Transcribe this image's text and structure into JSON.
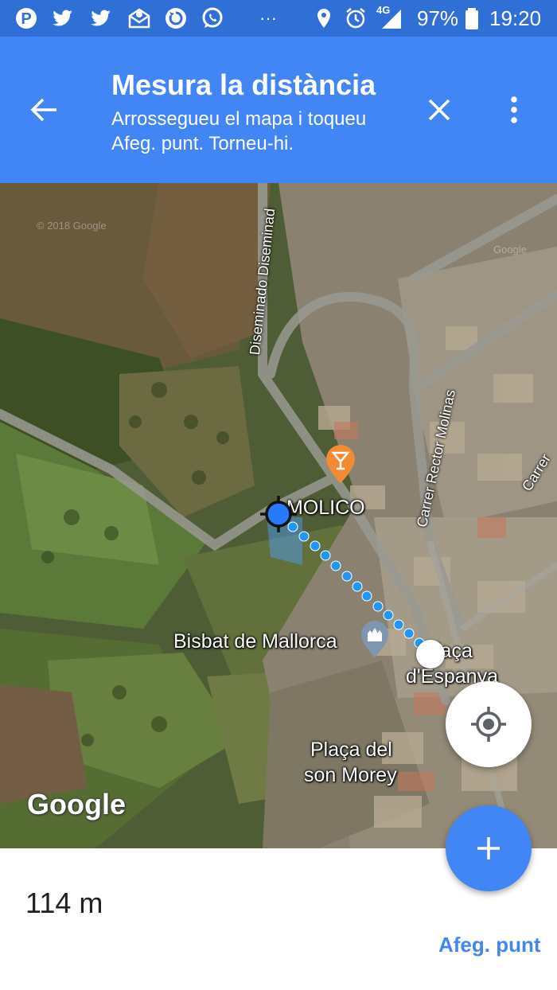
{
  "status_bar": {
    "notification_icons": [
      "pinterest-icon",
      "twitter-icon",
      "twitter-icon",
      "mail-icon",
      "sync-icon",
      "whatsapp-icon"
    ],
    "more_indicator": "···",
    "network_label": "4G",
    "battery": "97%",
    "time": "19:20"
  },
  "app_bar": {
    "title": "Mesura la distància",
    "subtitle": "Arrossegueu el mapa i toqueu Afeg. punt. Torneu-hi."
  },
  "map": {
    "labels": {
      "poi_molico": "MOLICO",
      "poi_bisbat": "Bisbat de Mallorca",
      "plaza_espanya_line1": "laça",
      "plaza_espanya_line2": "d'Espanya",
      "placa_son_morey_line1": "Plaça del",
      "placa_son_morey_line2": "son Morey",
      "street_diseminado": "Diseminado Diseminad",
      "street_rector_molinas": "Carrer Rector Molinas",
      "street_carrer": "Carrer",
      "copyright_1": "© 2018 Google",
      "copyright_2": "Google"
    },
    "google_logo": "Google",
    "measure_color": "#2196f3"
  },
  "bottom_sheet": {
    "distance": "114 m",
    "add_point_label": "Afeg. punt"
  },
  "colors": {
    "accent": "#4285f4",
    "status_bar": "#2f6fd6"
  }
}
